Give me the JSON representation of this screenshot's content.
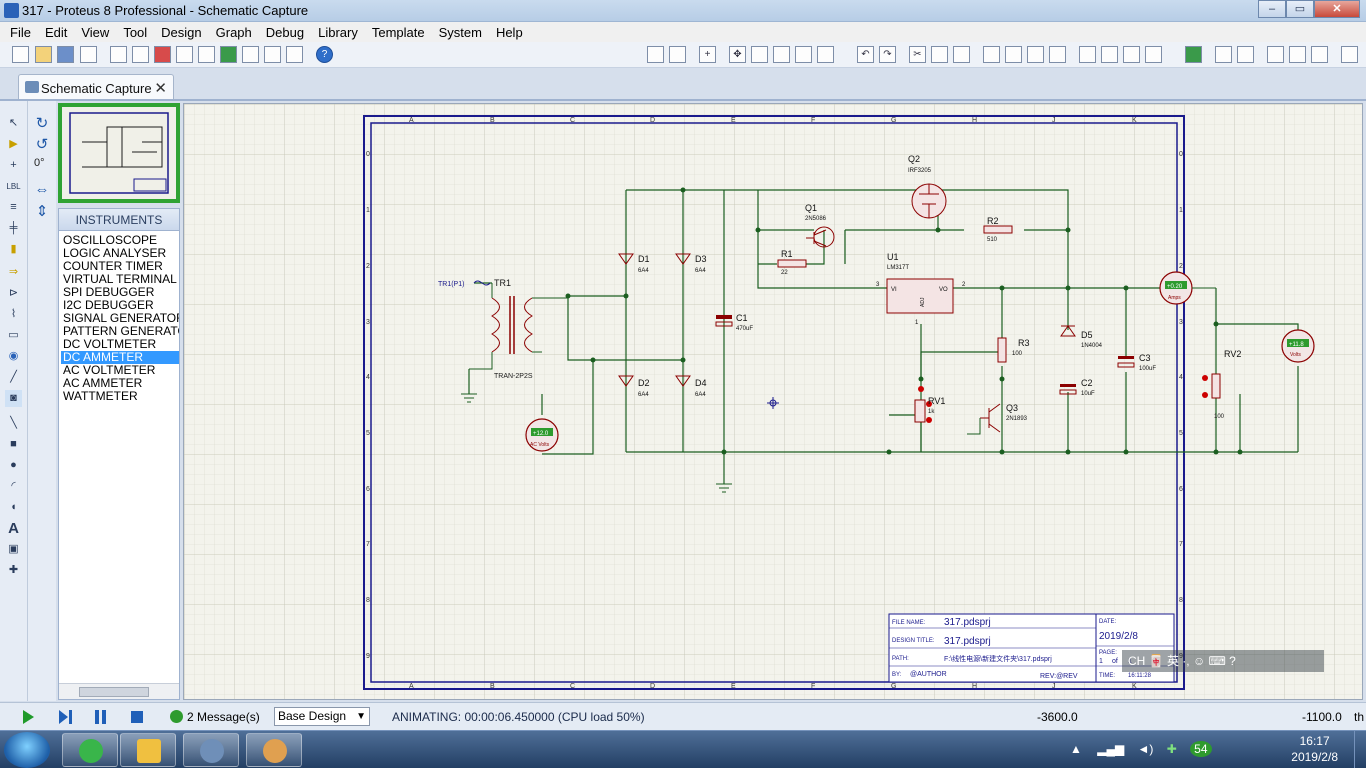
{
  "window": {
    "title": "317 - Proteus 8 Professional - Schematic Capture",
    "controls": [
      "–",
      "▭",
      "✕"
    ]
  },
  "menu": [
    "File",
    "Edit",
    "View",
    "Tool",
    "Design",
    "Graph",
    "Debug",
    "Library",
    "Template",
    "System",
    "Help"
  ],
  "tab": {
    "label": "Schematic Capture",
    "close": "✕"
  },
  "rotation": {
    "angle": "0°"
  },
  "instruments": {
    "header": "INSTRUMENTS",
    "items": [
      "OSCILLOSCOPE",
      "LOGIC ANALYSER",
      "COUNTER TIMER",
      "VIRTUAL TERMINAL",
      "SPI DEBUGGER",
      "I2C DEBUGGER",
      "SIGNAL GENERATOR",
      "PATTERN GENERATO",
      "DC VOLTMETER",
      "DC AMMETER",
      "AC VOLTMETER",
      "AC AMMETER",
      "WATTMETER"
    ],
    "selected": "DC AMMETER"
  },
  "schematic": {
    "border_cols": [
      "A",
      "B",
      "C",
      "D",
      "E",
      "F",
      "G",
      "H",
      "J",
      "K"
    ],
    "border_rows": [
      "0",
      "1",
      "2",
      "3",
      "4",
      "5",
      "6",
      "7",
      "8",
      "9"
    ],
    "components": {
      "tr1_source": "TR1(P1)",
      "tr1": "TR1",
      "tr1_type": "TRAN-2P2S",
      "d1": "D1",
      "d1_val": "6A4",
      "d2": "D2",
      "d2_val": "6A4",
      "d3": "D3",
      "d3_val": "6A4",
      "d4": "D4",
      "d4_val": "6A4",
      "c1": "C1",
      "c1_val": "470uF",
      "q1": "Q1",
      "q1_val": "2N5086",
      "q2": "Q2",
      "q2_val": "IRF3205",
      "r1": "R1",
      "r1_val": "22",
      "r2": "R2",
      "r2_val": "510",
      "u1": "U1",
      "u1_val": "LM317T",
      "u1_vi": "VI",
      "u1_vo": "VO",
      "u1_adj": "ADJ",
      "u1_pin3": "3",
      "u1_pin2": "2",
      "u1_pin1": "1",
      "r3": "R3",
      "r3_val": "100",
      "rv1": "RV1",
      "rv1_val": "1k",
      "q3": "Q3",
      "q3_val": "2N1893",
      "d5": "D5",
      "d5_val": "1N4004",
      "c2": "C2",
      "c2_val": "10uF",
      "c3": "C3",
      "c3_val": "100uF",
      "rv2": "RV2",
      "rv2_val": "100"
    },
    "meters": {
      "ac_volt_reading": "+12.0",
      "ac_volt_unit": "AC Volts",
      "amps_reading": "+0.20",
      "amps_unit": "Amps",
      "volts_reading": "+11.8",
      "volts_unit": "Volts"
    },
    "title_block": {
      "file_name_label": "FILE NAME:",
      "file_name": "317.pdsprj",
      "design_title_label": "DESIGN TITLE:",
      "design_title": "317.pdsprj",
      "path_label": "PATH:",
      "path": "F:\\线性电源\\新建文件夹\\317.pdsprj",
      "by_label": "BY:",
      "by": "@AUTHOR",
      "rev": "REV:@REV",
      "date_label": "DATE:",
      "date": "2019/2/8",
      "page_label": "PAGE:",
      "page": "1",
      "of": "of",
      "pages": "1",
      "time_label": "TIME:",
      "time": "16:11:28"
    }
  },
  "ime_bar": "CH 🀄 英 ·, ☺ ⌨ ?",
  "status": {
    "messages": "2 Message(s)",
    "design_select": "Base Design",
    "animating": "ANIMATING: 00:00:06.450000 (CPU load 50%)",
    "x_coord": "-3600.0",
    "y_coord": "-1100.0",
    "unit": "th"
  },
  "taskbar": {
    "clock_time": "16:17",
    "clock_date": "2019/2/8",
    "tray_badge": "54"
  },
  "colors": {
    "wire": "#1b5e20",
    "component": "#8b0000",
    "border": "#1a1a8c",
    "accent": "#2f6ec9"
  }
}
